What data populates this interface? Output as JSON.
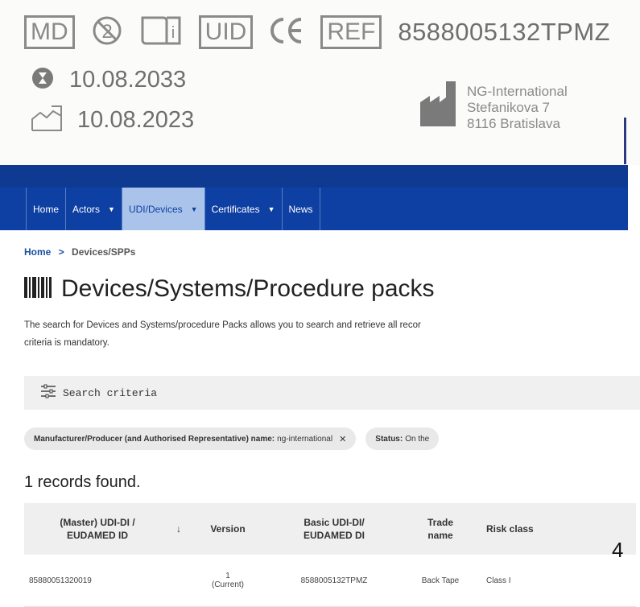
{
  "label": {
    "symbols": [
      "MD",
      "UID",
      "REF"
    ],
    "ref_code": "8588005132TPMZ",
    "expiry_date": "10.08.2033",
    "manufacture_date": "10.08.2023",
    "manufacturer": {
      "name": "NG-International",
      "street": "Stefanikova 7",
      "city": "8116 Bratislava"
    }
  },
  "nav": {
    "items": [
      {
        "label": "Home",
        "dropdown": false
      },
      {
        "label": "Actors",
        "dropdown": true
      },
      {
        "label": "UDI/Devices",
        "dropdown": true,
        "active": true
      },
      {
        "label": "Certificates",
        "dropdown": true
      },
      {
        "label": "News",
        "dropdown": false
      }
    ]
  },
  "breadcrumb": {
    "home": "Home",
    "separator": ">",
    "current": "Devices/SPPs"
  },
  "page": {
    "title": "Devices/Systems/Procedure packs",
    "description_line1": "The search for Devices and Systems/procedure Packs allows you to search and retrieve all recor",
    "description_line2": "criteria is mandatory."
  },
  "search": {
    "label": "Search criteria"
  },
  "filters": [
    {
      "key": "Manufacturer/Producer (and Authorised Representative) name:",
      "value": "ng-international"
    },
    {
      "key": "Status:",
      "value": "On the"
    }
  ],
  "results": {
    "count_text": "1 records found.",
    "headers": {
      "udi_line1": "(Master) UDI-DI /",
      "udi_line2": "EUDAMED ID",
      "sort_arrow": "↓",
      "version": "Version",
      "basic_line1": "Basic UDI-DI/",
      "basic_line2": "EUDAMED DI",
      "trade_line1": "Trade",
      "trade_line2": "name",
      "risk": "Risk class"
    },
    "rows": [
      {
        "udi": "85880051320019",
        "version_num": "1",
        "version_status": "(Current)",
        "basic_udi": "8588005132TPMZ",
        "trade_name": "Back Tape",
        "risk_class": "Class I"
      }
    ],
    "overflow_text": "4"
  },
  "colors": {
    "nav_bg": "#0e3fa3",
    "nav_active_bg": "#a9c3ea",
    "link": "#1a4ea0",
    "label_gray": "#8a8a8a"
  }
}
